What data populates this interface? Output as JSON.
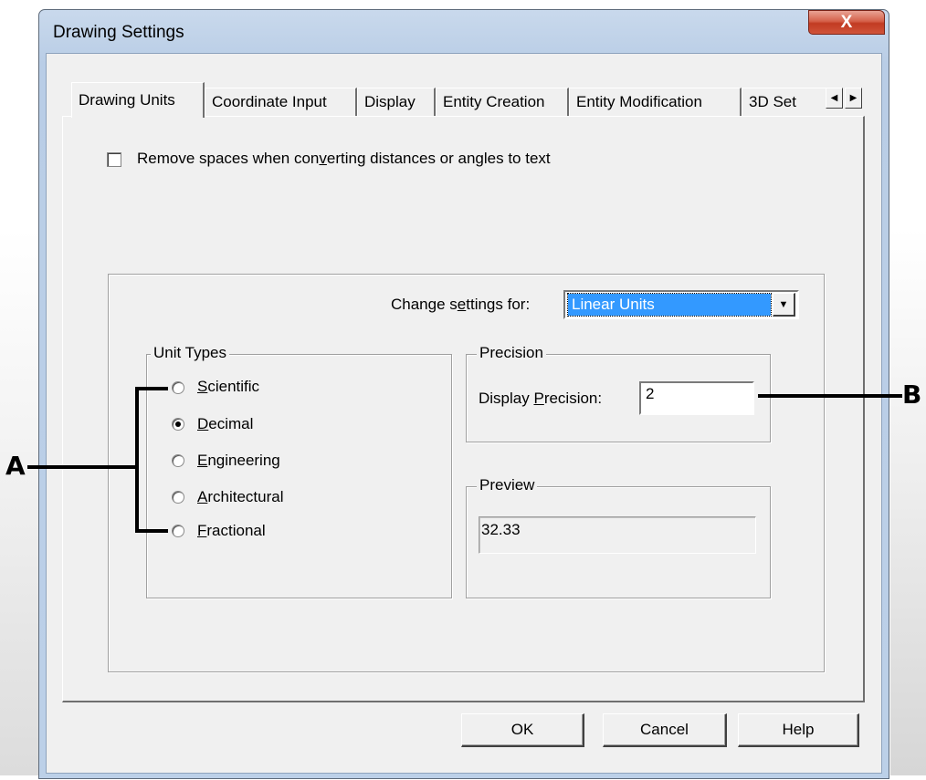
{
  "window": {
    "title": "Drawing Settings",
    "close_glyph": "X"
  },
  "tabs": [
    {
      "label": "Drawing Units",
      "active": true
    },
    {
      "label": "Coordinate Input"
    },
    {
      "label": "Display"
    },
    {
      "label": "Entity Creation"
    },
    {
      "label": "Entity Modification"
    },
    {
      "label": "3D Set"
    }
  ],
  "tab_scroll": {
    "left_icon": "arrow-left-icon",
    "right_icon": "arrow-right-icon",
    "left_glyph": "◀",
    "right_glyph": "▶"
  },
  "options": {
    "remove_spaces": {
      "label_pre": "Remove spaces when con",
      "label_access": "v",
      "label_post": "erting distances or angles to text",
      "checked": false
    }
  },
  "change_settings": {
    "label_pre": "Change s",
    "label_access": "e",
    "label_post": "ttings for:",
    "selected": "Linear Units",
    "arrow_glyph": "▼"
  },
  "unit_types": {
    "caption": "Unit Types",
    "items": [
      {
        "access": "S",
        "rest": "cientific",
        "checked": false
      },
      {
        "access": "D",
        "rest": "ecimal",
        "checked": true
      },
      {
        "access": "E",
        "rest": "ngineering",
        "checked": false
      },
      {
        "access": "A",
        "rest": "rchitectural",
        "checked": false
      },
      {
        "access": "F",
        "rest": "ractional",
        "checked": false
      }
    ]
  },
  "precision": {
    "caption": "Precision",
    "label_pre": "Display ",
    "label_access": "P",
    "label_post": "recision:",
    "value": "2"
  },
  "preview": {
    "caption": "Preview",
    "value": "32.33"
  },
  "buttons": {
    "ok": "OK",
    "cancel": "Cancel",
    "help": "Help"
  },
  "callouts": {
    "a": "A",
    "b": "B"
  }
}
